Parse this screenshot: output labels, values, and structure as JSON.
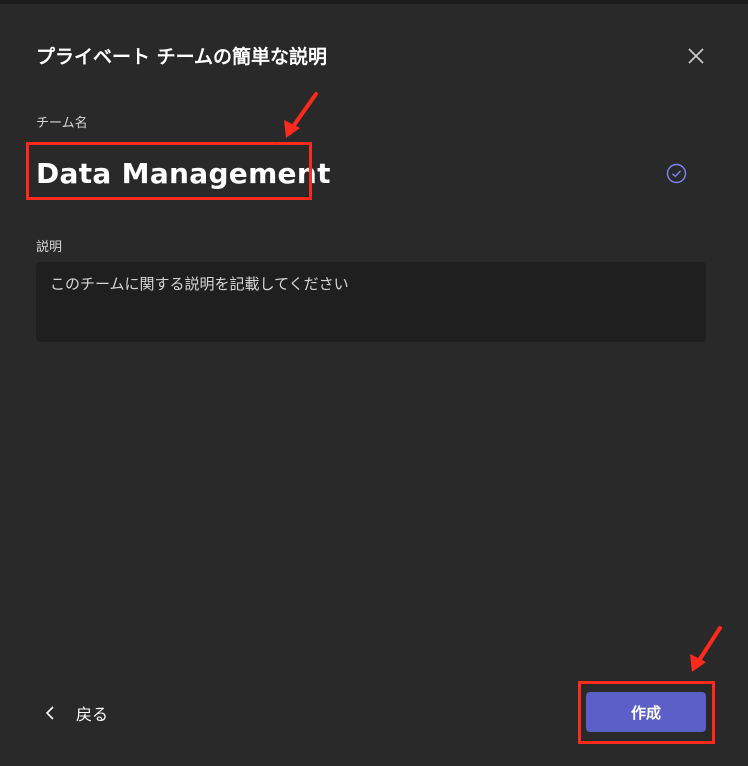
{
  "dialog": {
    "title": "プライベート チームの簡単な説明",
    "close_icon": "close-icon"
  },
  "team_name": {
    "label": "チーム名",
    "value": "Data Management",
    "valid_icon": "check-circle-icon"
  },
  "description": {
    "label": "説明",
    "placeholder": "このチームに関する説明を記載してください"
  },
  "footer": {
    "back_label": "戻る",
    "create_label": "作成"
  },
  "colors": {
    "background": "#292929",
    "primary_button": "#5b5fc7",
    "annotation_red": "#ff2a1c",
    "check_icon": "#7f85f5"
  }
}
